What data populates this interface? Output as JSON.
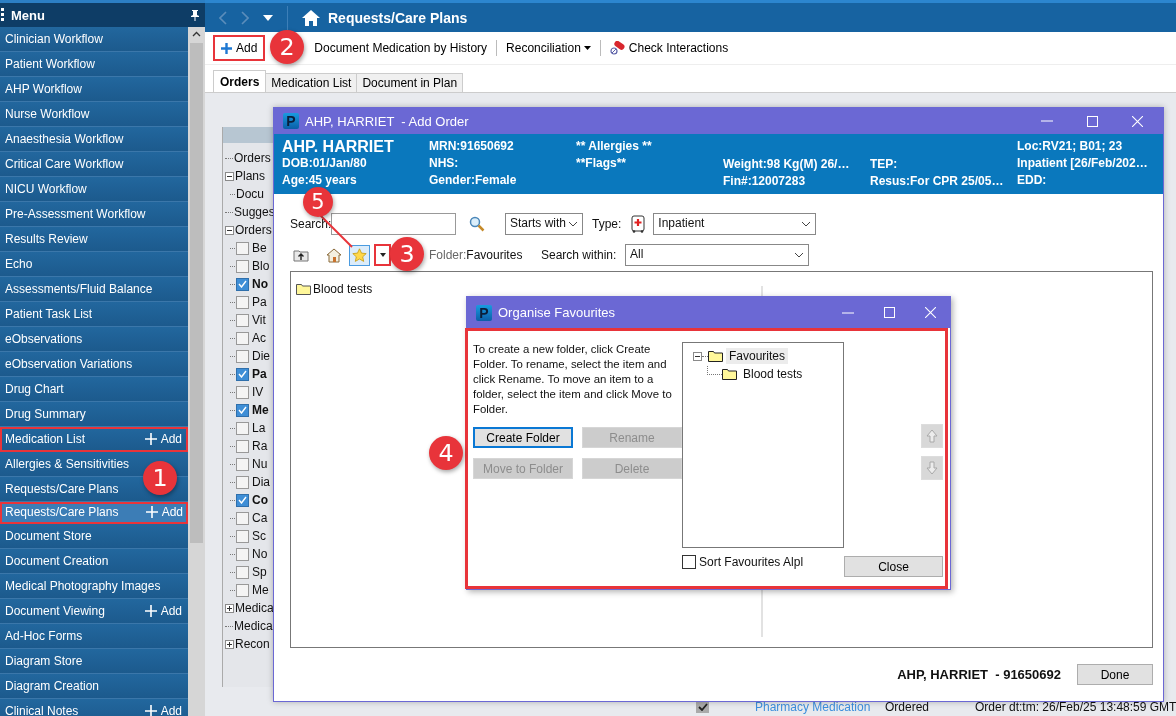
{
  "menu": {
    "title": "Menu",
    "items": [
      {
        "label": "Clinician Workflow",
        "selected": false,
        "highlighted": false
      },
      {
        "label": "Patient Workflow",
        "selected": false,
        "highlighted": false
      },
      {
        "label": "AHP Workflow",
        "selected": false,
        "highlighted": false
      },
      {
        "label": "Nurse Workflow",
        "selected": false,
        "highlighted": false
      },
      {
        "label": "Anaesthesia Workflow",
        "selected": false,
        "highlighted": false
      },
      {
        "label": "Critical Care Workflow",
        "selected": false,
        "highlighted": false
      },
      {
        "label": "NICU Workflow",
        "selected": false,
        "highlighted": false
      },
      {
        "label": "Pre-Assessment Workflow",
        "selected": false,
        "highlighted": false
      },
      {
        "label": "Results Review",
        "selected": false,
        "highlighted": false
      },
      {
        "label": "Echo",
        "selected": false,
        "highlighted": false
      },
      {
        "label": "Assessments/Fluid Balance",
        "selected": false,
        "highlighted": false
      },
      {
        "label": "Patient Task List",
        "selected": false,
        "highlighted": false
      },
      {
        "label": "eObservations",
        "selected": false,
        "highlighted": false
      },
      {
        "label": "eObservation Variations",
        "selected": false,
        "highlighted": false
      },
      {
        "label": "Drug Chart",
        "selected": false,
        "highlighted": false
      },
      {
        "label": "Drug Summary",
        "selected": false,
        "highlighted": false
      },
      {
        "label": "Medication List",
        "add_label": "Add",
        "selected": false,
        "highlighted": true
      },
      {
        "label": "Allergies & Sensitivities",
        "selected": false,
        "highlighted": false
      },
      {
        "label": "Requests/Care Plans",
        "selected": false,
        "highlighted": false
      },
      {
        "label": "Requests/Care Plans",
        "add_label": "Add",
        "selected": true,
        "highlighted": true
      },
      {
        "label": "Document Store",
        "selected": false,
        "highlighted": false
      },
      {
        "label": "Document Creation",
        "selected": false,
        "highlighted": false
      },
      {
        "label": "Medical Photography Images",
        "selected": false,
        "highlighted": false
      },
      {
        "label": "Document Viewing",
        "add_label": "Add",
        "selected": false,
        "highlighted": false
      },
      {
        "label": "Ad-Hoc Forms",
        "selected": false,
        "highlighted": false
      },
      {
        "label": "Diagram Store",
        "selected": false,
        "highlighted": false
      },
      {
        "label": "Diagram Creation",
        "selected": false,
        "highlighted": false
      },
      {
        "label": "Clinical Notes",
        "add_label": "Add",
        "selected": false,
        "highlighted": false
      }
    ]
  },
  "topbar": {
    "title": "Requests/Care Plans"
  },
  "toolbar": {
    "add": {
      "label": "Add",
      "highlighted": true
    },
    "items": [
      {
        "label": "Document Medication by History",
        "kind": "plain"
      },
      {
        "label": "Reconciliation",
        "kind": "menu"
      },
      {
        "label": "Check Interactions",
        "kind": "icon"
      }
    ]
  },
  "tabs": [
    {
      "label": "Orders",
      "selected": true
    },
    {
      "label": "Medication List",
      "selected": false
    },
    {
      "label": "Document in Plan",
      "selected": false
    }
  ],
  "orders_tree": [
    {
      "label": "Orders"
    },
    {
      "label": "Plans",
      "expanded": true,
      "children": [
        {
          "label": "Docu"
        }
      ]
    },
    {
      "label": "Sugges"
    },
    {
      "label": "Orders",
      "expanded": true,
      "children": [
        {
          "label": "Be",
          "checked": false
        },
        {
          "label": "Blo",
          "checked": false
        },
        {
          "label": "No",
          "checked": true
        },
        {
          "label": "Pa",
          "checked": false
        },
        {
          "label": "Vit",
          "checked": false
        },
        {
          "label": "Ac",
          "checked": false
        },
        {
          "label": "Die",
          "checked": false
        },
        {
          "label": "Pa",
          "checked": true
        },
        {
          "label": "IV",
          "checked": false
        },
        {
          "label": "Me",
          "checked": true
        },
        {
          "label": "La",
          "checked": false
        },
        {
          "label": "Ra",
          "checked": false
        },
        {
          "label": "Nu",
          "checked": false
        },
        {
          "label": "Dia",
          "checked": false
        },
        {
          "label": "Co",
          "checked": true
        },
        {
          "label": "Ca",
          "checked": false
        },
        {
          "label": "Sc",
          "checked": false
        },
        {
          "label": "No",
          "checked": false
        },
        {
          "label": "Sp",
          "checked": false
        },
        {
          "label": "Me",
          "checked": false
        }
      ]
    },
    {
      "label": "Medica",
      "expanded": false
    },
    {
      "label": "Medica"
    },
    {
      "label": "Recon",
      "expanded": false
    }
  ],
  "add_order": {
    "logo": "P",
    "title": "AHP, HARRIET  - Add Order",
    "banner": [
      {
        "kind": "top",
        "lines": [
          "AHP. HARRIET",
          "DOB:01/Jan/80",
          "Age:45 years"
        ]
      },
      {
        "kind": "top",
        "lines": [
          "MRN:91650692",
          "NHS:",
          "Gender:Female"
        ]
      },
      {
        "kind": "top",
        "lines": [
          "** Allergies **",
          "**Flags**"
        ]
      },
      {
        "kind": "bottom",
        "lines": [
          "Weight:98 Kg(M) 26/…",
          "Fin#:12007283"
        ]
      },
      {
        "kind": "bottom",
        "lines": [
          "TEP:",
          "Resus:For CPR  25/05…"
        ]
      },
      {
        "kind": "top",
        "lines": [
          "Loc:RV21; B01; 23",
          "Inpatient [26/Feb/202…",
          "EDD:"
        ]
      }
    ],
    "search": {
      "label": "Search:",
      "mode": "Starts with",
      "type_label": "Type:",
      "type": "Inpatient"
    },
    "folder_bar": {
      "favourites_pressed": true,
      "dropdown_highlighted": true,
      "folder_label": "Folder:",
      "folder": "Favourites",
      "within_label": "Search within:",
      "within": "All"
    },
    "list": [
      {
        "label": "Blood tests"
      }
    ],
    "footer": {
      "patient": "AHP, HARRIET  - 91650692",
      "done": "Done"
    }
  },
  "organise": {
    "logo": "P",
    "title": "Organise Favourites",
    "highlighted": true,
    "instructions": "To create a new folder, click Create Folder. To rename, select the item and click Rename. To move an item to a folder, select the item and click Move to Folder.",
    "buttons": [
      {
        "label": "Create Folder",
        "disabled": false,
        "focused": true
      },
      {
        "label": "Rename",
        "disabled": true,
        "focused": false
      },
      {
        "label": "Move to Folder",
        "disabled": true,
        "focused": false
      },
      {
        "label": "Delete",
        "disabled": true,
        "focused": false
      }
    ],
    "tree": [
      {
        "label": "Favourites",
        "expanded": true,
        "selected": true,
        "children": [
          {
            "label": "Blood tests",
            "selected": false
          }
        ]
      }
    ],
    "move_up_disabled": true,
    "move_down_disabled": true,
    "sort": {
      "label": "Sort Favourites Alpl",
      "checked": false
    },
    "close": "Close"
  },
  "background_row": {
    "checked": true,
    "link": "Pharmacy Medication",
    "status": "Ordered",
    "detail": "Order dt:tm: 26/Feb/25 13:48:59 GMT"
  },
  "callouts": [
    "1",
    "2",
    "3",
    "4",
    "5"
  ]
}
